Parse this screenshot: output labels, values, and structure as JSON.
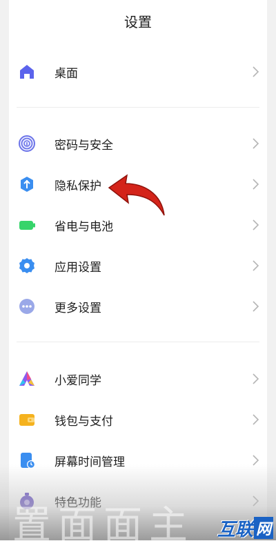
{
  "header": {
    "title": "设置"
  },
  "groups": [
    {
      "items": [
        {
          "label": "桌面",
          "icon": "home-icon",
          "color": "#5b63ec"
        }
      ]
    },
    {
      "items": [
        {
          "label": "密码与安全",
          "icon": "fingerprint-icon",
          "color": "#6b73e8"
        },
        {
          "label": "隐私保护",
          "icon": "privacy-shield-icon",
          "color": "#3a8ef0"
        },
        {
          "label": "省电与电池",
          "icon": "battery-icon",
          "color": "#36d46a"
        },
        {
          "label": "应用设置",
          "icon": "gear-icon",
          "color": "#3a8ef0"
        },
        {
          "label": "更多设置",
          "icon": "more-dots-icon",
          "color": "#9aa8e8"
        }
      ]
    },
    {
      "items": [
        {
          "label": "小爱同学",
          "icon": "xiaoai-icon",
          "color": "#8a5cf0"
        },
        {
          "label": "钱包与支付",
          "icon": "wallet-icon",
          "color": "#f5b21e"
        },
        {
          "label": "屏幕时间管理",
          "icon": "screen-time-icon",
          "color": "#3a8ef0"
        },
        {
          "label": "特色功能",
          "icon": "features-icon",
          "color": "#6b55c8"
        }
      ]
    }
  ],
  "overlay": {
    "arrow_color": "#d4241a",
    "ghost_text": "置面面主",
    "watermark_main": "互联",
    "watermark_box": "网"
  }
}
